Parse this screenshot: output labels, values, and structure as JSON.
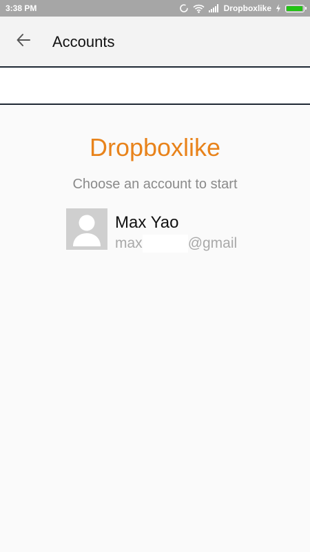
{
  "status_bar": {
    "time": "3:38 PM",
    "app_name": "Dropboxlike",
    "battery_level": 0.95,
    "battery_color": "#22c414",
    "icons": [
      "sync-icon",
      "wifi-icon",
      "signal-icon",
      "charging-icon",
      "battery-icon"
    ]
  },
  "app_bar": {
    "title": "Accounts",
    "back_icon": "arrow-left-icon"
  },
  "main": {
    "brand_title": "Dropboxlike",
    "brand_color": "#e8831b",
    "subtitle": "Choose an account to start",
    "accounts": [
      {
        "name": "Max Yao",
        "email_prefix": "max",
        "email_suffix": "@gmail",
        "avatar_icon": "person-icon"
      }
    ]
  }
}
